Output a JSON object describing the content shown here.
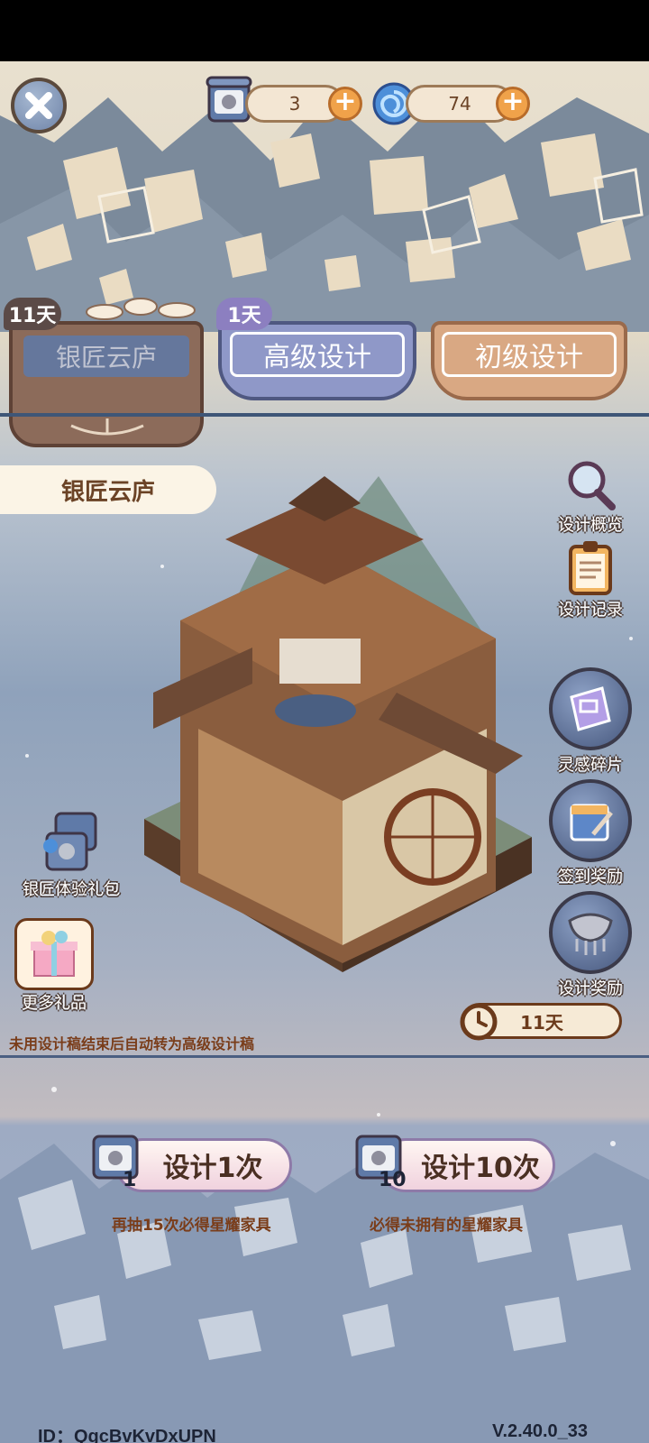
{
  "resources": {
    "scroll_count": "3",
    "swirl_count": "74"
  },
  "tabs": [
    {
      "label": "银匠云庐",
      "days": "11天"
    },
    {
      "label": "高级设计",
      "days": "1天"
    },
    {
      "label": "初级设计"
    }
  ],
  "pool_title": "银匠云庐",
  "side_menu": {
    "overview": "设计概览",
    "records": "设计记录",
    "fragments": "灵感碎片",
    "checkin": "签到奖励",
    "reward": "设计奖励"
  },
  "left_menu": {
    "trial_pack": "银匠体验礼包",
    "more_gifts": "更多礼品"
  },
  "timer": "11天",
  "notice": "未用设计稿结束后自动转为高级设计稿",
  "draw": {
    "single_label": "设计1次",
    "single_cost": "1",
    "single_sub": "再抽15次必得星耀家具",
    "ten_label": "设计10次",
    "ten_cost": "10",
    "ten_sub": "必得未拥有的星耀家具"
  },
  "footer": {
    "id": "ID：QgcBvKvDxUPN",
    "version": "V.2.40.0_33"
  },
  "colors": {
    "tab_active": "#8f98c8",
    "tab_primary": "#d9a883",
    "tab_event": "#8c6b5a",
    "accent_orange": "#f0a24a"
  }
}
